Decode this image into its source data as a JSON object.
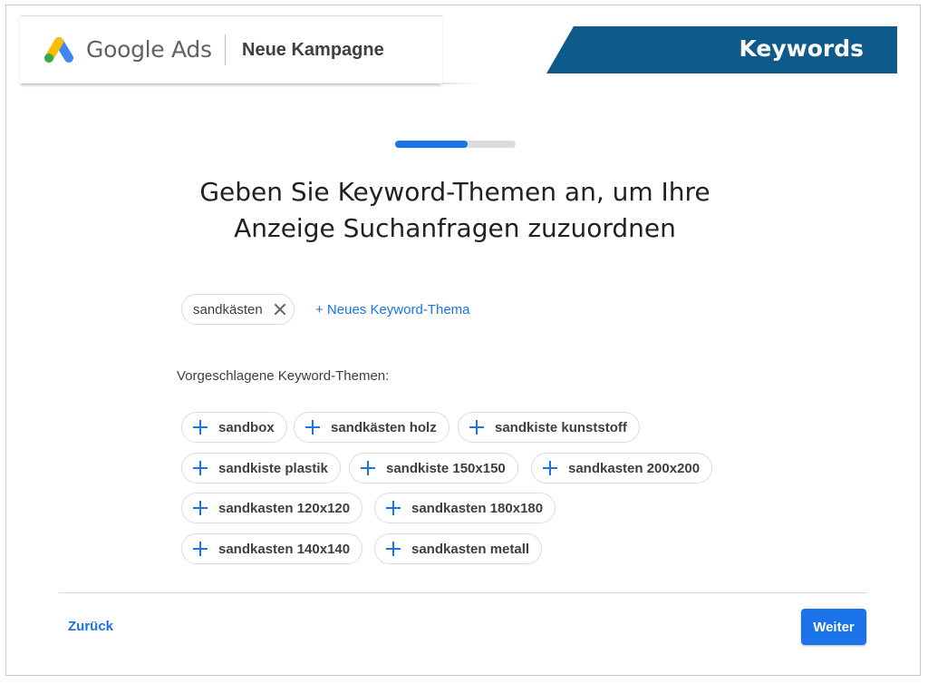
{
  "header": {
    "logo_text": "Google Ads",
    "campaign_title": "Neue Kampagne",
    "banner_label": "Keywords"
  },
  "progress": {
    "fraction": 0.6
  },
  "heading": {
    "line1": "Geben Sie Keyword-Themen an, um Ihre",
    "line2": "Anzeige Suchanfragen zuzuordnen"
  },
  "selected_keywords": [
    {
      "label": "sandkästen"
    }
  ],
  "add_keyword_label": "+ Neues Keyword-Thema",
  "suggestions_label": "Vorgeschlagene Keyword-Themen:",
  "suggestions": [
    {
      "label": "sandbox"
    },
    {
      "label": "sandkästen holz"
    },
    {
      "label": "sandkiste kunststoff"
    },
    {
      "label": "sandkiste plastik"
    },
    {
      "label": "sandkiste 150x150"
    },
    {
      "label": "sandkasten 200x200"
    },
    {
      "label": "sandkasten 120x120"
    },
    {
      "label": "sandkasten 180x180"
    },
    {
      "label": "sandkasten 140x140"
    },
    {
      "label": "sandkasten metall"
    }
  ],
  "footer": {
    "back_label": "Zurück",
    "next_label": "Weiter"
  },
  "colors": {
    "accent": "#1a73e8",
    "banner": "#0e5a8a",
    "google_blue": "#4285f4",
    "google_yellow": "#fbbc04",
    "google_green": "#34a853"
  }
}
